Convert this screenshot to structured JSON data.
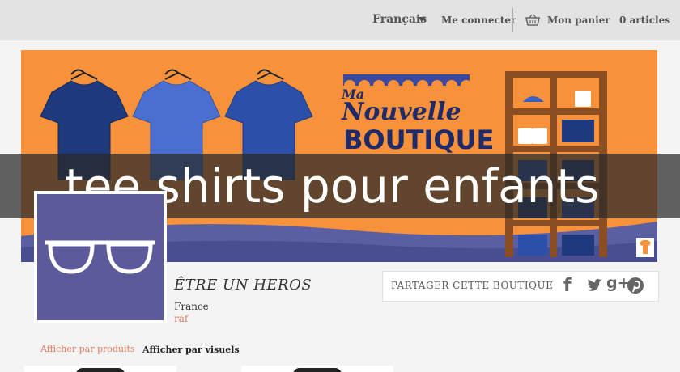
{
  "topbar": {
    "language": "Français",
    "login": "Me connecter",
    "cart": "Mon panier",
    "cart_count": "0 articles"
  },
  "banner": {
    "line1": "Ma",
    "line2": "Nouvelle",
    "line3": "BOUTIQUE",
    "colors": {
      "background": "#f7913a",
      "shirt_dark": "#1e3a7c",
      "shirt_light": "#4a6fd0",
      "shelf": "#8a4e22"
    }
  },
  "overlay": {
    "headline": "tee shirts pour enfants"
  },
  "shop": {
    "name": "ÊTRE UN HEROS",
    "country": "France",
    "owner": "raf",
    "avatar_color": "#5c5a9a"
  },
  "share": {
    "label": "PARTAGER CETTE BOUTIQUE",
    "icons": [
      "facebook-icon",
      "twitter-icon",
      "google-plus-icon",
      "pinterest-icon"
    ],
    "facebook_glyph": "f",
    "googleplus_glyph": "g+"
  },
  "views": {
    "by_products": "Afficher par produits",
    "by_visuals": "Afficher par visuels"
  }
}
